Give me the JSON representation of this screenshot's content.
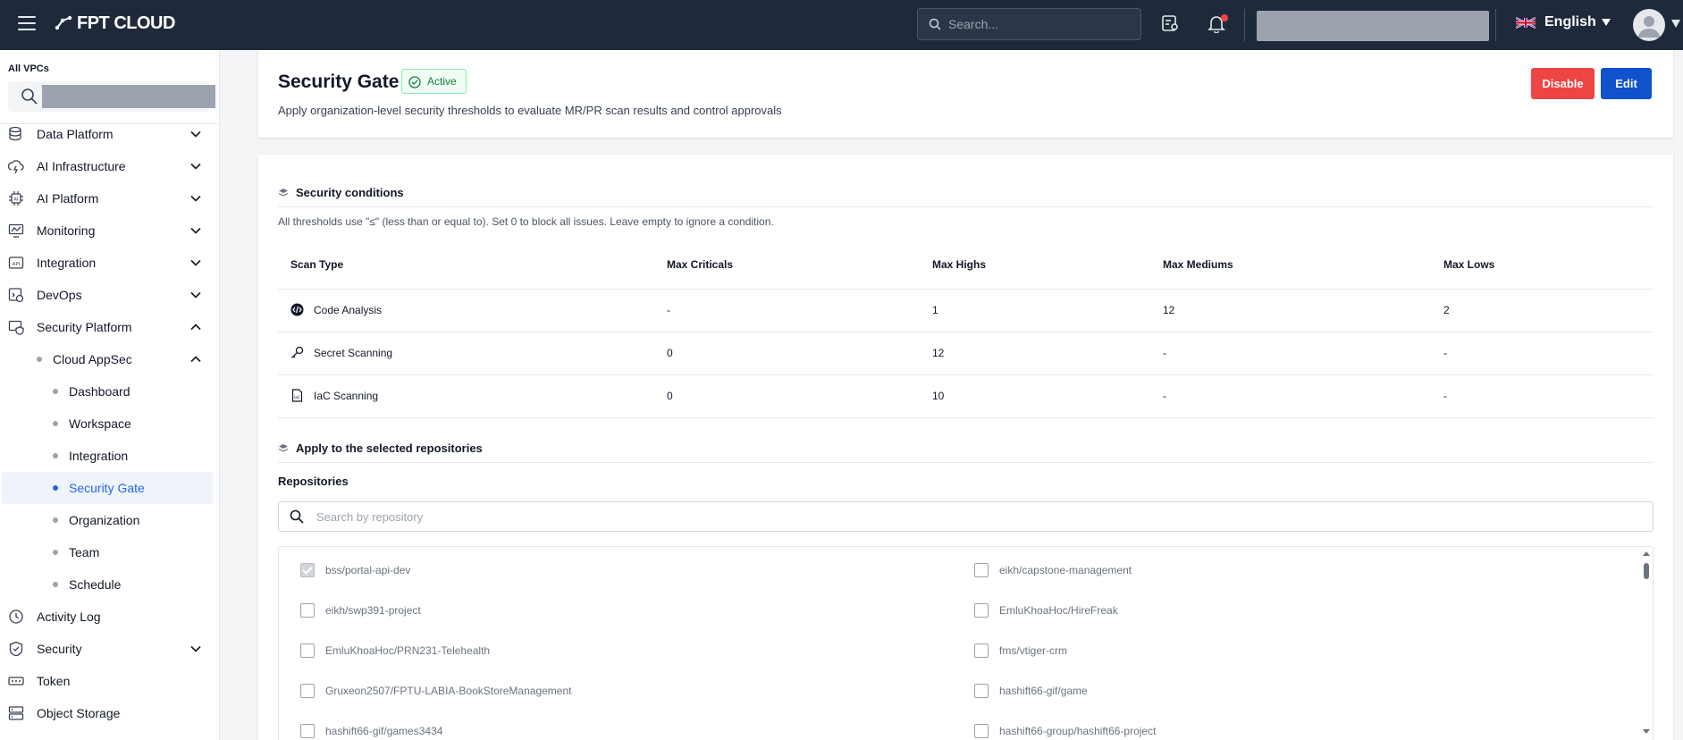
{
  "topbar": {
    "brand": "FPT CLOUD",
    "search_placeholder": "Search...",
    "language": "English"
  },
  "sidebar": {
    "vpc_label": "All VPCs",
    "items": [
      {
        "label": "Data Platform",
        "icon": "database-icon",
        "expandable": true,
        "expanded": false
      },
      {
        "label": "AI Infrastructure",
        "icon": "cloud-lightning-icon",
        "expandable": true,
        "expanded": false
      },
      {
        "label": "AI Platform",
        "icon": "ai-chip-icon",
        "expandable": true,
        "expanded": false
      },
      {
        "label": "Monitoring",
        "icon": "monitor-chart-icon",
        "expandable": true,
        "expanded": false
      },
      {
        "label": "Integration",
        "icon": "api-icon",
        "expandable": true,
        "expanded": false
      },
      {
        "label": "DevOps",
        "icon": "devops-icon",
        "expandable": true,
        "expanded": false
      },
      {
        "label": "Security Platform",
        "icon": "security-platform-icon",
        "expandable": true,
        "expanded": true
      }
    ],
    "sub_parent": "Cloud AppSec",
    "sub_items": [
      "Dashboard",
      "Workspace",
      "Integration",
      "Security Gate",
      "Organization",
      "Team",
      "Schedule"
    ],
    "active_sub": "Security Gate",
    "bottom_items": [
      {
        "label": "Activity Log",
        "icon": "clock-icon",
        "expandable": false
      },
      {
        "label": "Security",
        "icon": "shield-icon",
        "expandable": true
      },
      {
        "label": "Token",
        "icon": "token-icon",
        "expandable": false
      },
      {
        "label": "Object Storage",
        "icon": "storage-icon",
        "expandable": false
      }
    ]
  },
  "header": {
    "title": "Security Gate",
    "status": "Active",
    "description": "Apply organization-level security thresholds to evaluate MR/PR scan results and control approvals",
    "disable_label": "Disable",
    "edit_label": "Edit"
  },
  "conditions": {
    "title": "Security conditions",
    "note": "All thresholds use \"≤\" (less than or equal to). Set 0 to block all issues. Leave empty to ignore a condition.",
    "columns": [
      "Scan Type",
      "Max Criticals",
      "Max Highs",
      "Max Mediums",
      "Max Lows"
    ],
    "rows": [
      {
        "type": "Code Analysis",
        "icon": "code-icon",
        "criticals": "-",
        "highs": "1",
        "mediums": "12",
        "lows": "2"
      },
      {
        "type": "Secret Scanning",
        "icon": "key-icon",
        "criticals": "0",
        "highs": "12",
        "mediums": "-",
        "lows": "-"
      },
      {
        "type": "IaC Scanning",
        "icon": "iac-file-icon",
        "criticals": "0",
        "highs": "10",
        "mediums": "-",
        "lows": "-"
      }
    ]
  },
  "repositories": {
    "section_title": "Apply to the selected repositories",
    "label": "Repositories",
    "search_placeholder": "Search by repository",
    "left": [
      {
        "name": "bss/portal-api-dev",
        "checked": true
      },
      {
        "name": "eikh/swp391-project",
        "checked": false
      },
      {
        "name": "EmluKhoaHoc/PRN231-Telehealth",
        "checked": false
      },
      {
        "name": "Gruxeon2507/FPTU-LABIA-BookStoreManagement",
        "checked": false
      },
      {
        "name": "hashift66-gif/games3434",
        "checked": false
      }
    ],
    "right": [
      {
        "name": "eikh/capstone-management",
        "checked": false
      },
      {
        "name": "EmluKhoaHoc/HireFreak",
        "checked": false
      },
      {
        "name": "fms/vtiger-crm",
        "checked": false
      },
      {
        "name": "hashift66-gif/game",
        "checked": false
      },
      {
        "name": "hashift66-group/hashift66-project",
        "checked": false
      }
    ]
  },
  "colors": {
    "topbar": "#1e2a3b",
    "accent": "#2563eb",
    "danger": "#ef4444",
    "primary": "#0f52cc",
    "success": "#15803d"
  }
}
